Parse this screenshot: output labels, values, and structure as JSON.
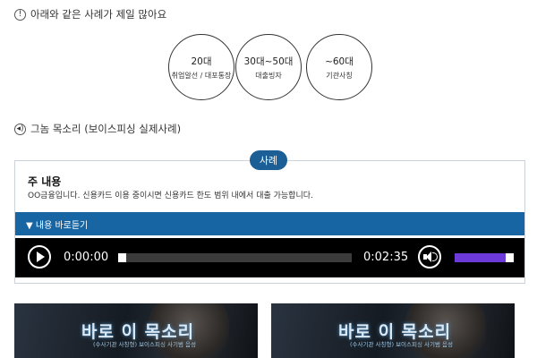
{
  "section1": {
    "icon": "exclamation-circle-icon",
    "title": "아래와 같은 사례가 제일 많아요"
  },
  "circles": [
    {
      "age": "20대",
      "keyword": "취업알선 / 대포통장"
    },
    {
      "age": "30대~50대",
      "keyword": "대출빙자"
    },
    {
      "age": "~60대",
      "keyword": "기관사칭"
    }
  ],
  "section2": {
    "icon": "speaker-circle-icon",
    "title": "그놈 목소리 (보이스피싱 실제사례)"
  },
  "example": {
    "badge": "사례",
    "heading": "주 내용",
    "body": "OO금융입니다. 신용카드 이용 중이시면 신용카드 한도 범위 내에서 대출 가능합니다.",
    "shortcut_label": "▼ 내용 바로듣기"
  },
  "player": {
    "current_time": "0:00:00",
    "duration": "0:02:35",
    "progress": 0,
    "volume": 1.0,
    "volume_color": "#6b3ad9"
  },
  "banners": [
    {
      "title": "바로 이 목소리",
      "subtitle": "(수사기관 사칭형) 보이스피싱 사기범 음성"
    },
    {
      "title": "바로 이 목소리",
      "subtitle": "(수사기관 사칭형) 보이스피싱 사기범 음성"
    }
  ],
  "colors": {
    "primary": "#1766a3",
    "badge": "#1b5f96",
    "player_bg": "#000000"
  }
}
